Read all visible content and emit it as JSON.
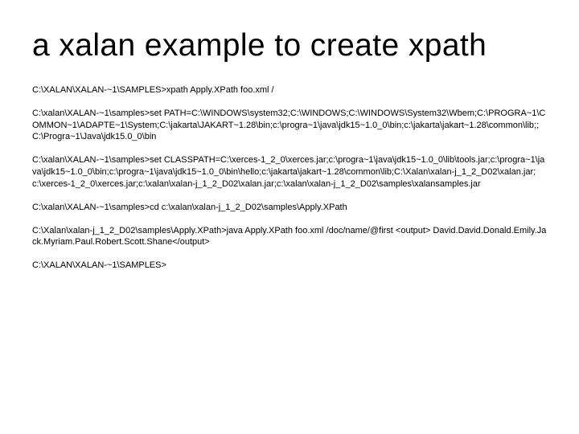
{
  "title": "a xalan example to create xpath",
  "blocks": [
    "C:\\XALAN\\XALAN-~1\\SAMPLES>xpath Apply.XPath foo.xml /",
    "C:\\xalan\\XALAN-~1\\samples>set PATH=C:\\WINDOWS\\system32;C:\\WINDOWS;C:\\WINDOWS\\System32\\Wbem;C:\\PROGRA~1\\COMMON~1\\ADAPTE~1\\System;C:\\jakarta\\JAKART~1.28\\bin;c:\\progra~1\\java\\jdk15~1.0_0\\bin;c:\\jakarta\\jakart~1.28\\common\\lib;;C:\\Progra~1\\Java\\jdk15.0_0\\bin",
    "C:\\xalan\\XALAN-~1\\samples>set CLASSPATH=C:\\xerces-1_2_0\\xerces.jar;c:\\progra~1\\java\\jdk15~1.0_0\\lib\\tools.jar;c:\\progra~1\\java\\jdk15~1.0_0\\bin;c:\\progra~1\\java\\jdk15~1.0_0\\bin\\hello;c:\\jakarta\\jakart~1.28\\common\\lib;C:\\Xalan\\xalan-j_1_2_D02\\xalan.jar;c:\\xerces-1_2_0\\xerces.jar;c:\\xalan\\xalan-j_1_2_D02\\xalan.jar;c:\\xalan\\xalan-j_1_2_D02\\samples\\xalansamples.jar",
    "C:\\xalan\\XALAN-~1\\samples>cd c:\\xalan\\xalan-j_1_2_D02\\samples\\Apply.XPath",
    "C:\\Xalan\\xalan-j_1_2_D02\\samples\\Apply.XPath>java Apply.XPath foo.xml /doc/name/@first\n<output>\nDavid.David.Donald.Emily.Jack.Myriam.Paul.Robert.Scott.Shane</output>",
    "C:\\XALAN\\XALAN-~1\\SAMPLES>"
  ]
}
